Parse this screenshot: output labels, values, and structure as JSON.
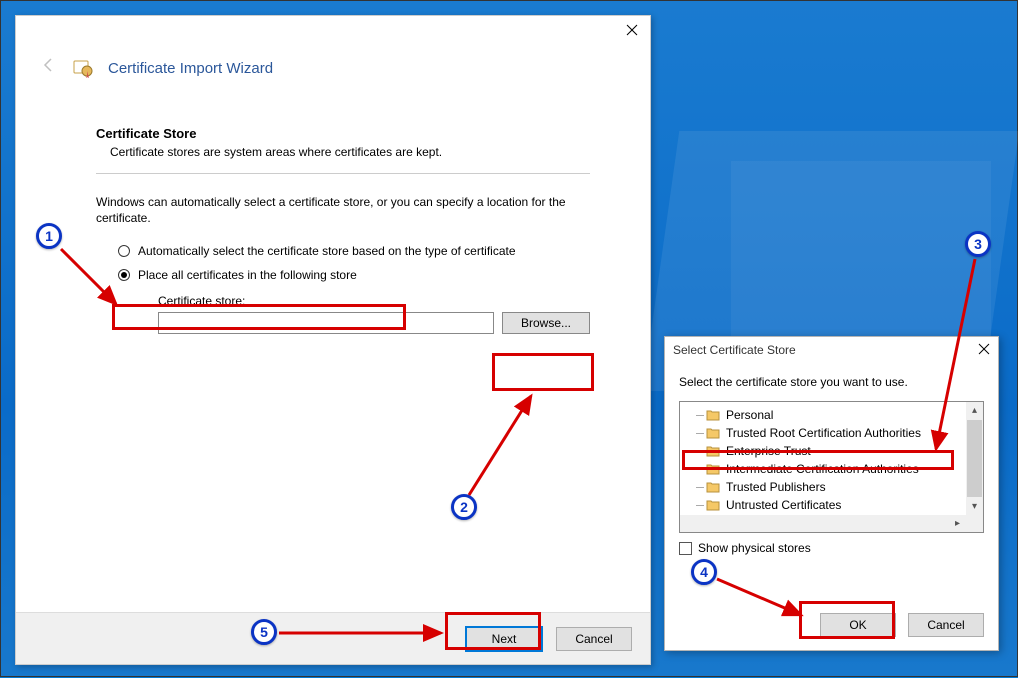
{
  "wizard": {
    "title": "Certificate Import Wizard",
    "section_title": "Certificate Store",
    "section_desc": "Certificate stores are system areas where certificates are kept.",
    "instruction": "Windows can automatically select a certificate store, or you can specify a location for the certificate.",
    "radio_auto": "Automatically select the certificate store based on the type of certificate",
    "radio_place": "Place all certificates in the following store",
    "store_label": "Certificate store:",
    "store_value": "",
    "browse": "Browse...",
    "next": "Next",
    "cancel": "Cancel"
  },
  "sel": {
    "title": "Select Certificate Store",
    "instruction": "Select the certificate store you want to use.",
    "items": {
      "0": "Personal",
      "1": "Trusted Root Certification Authorities",
      "2": "Enterprise Trust",
      "3": "Intermediate Certification Authorities",
      "4": "Trusted Publishers",
      "5": "Untrusted Certificates"
    },
    "show_physical": "Show physical stores",
    "ok": "OK",
    "cancel": "Cancel"
  },
  "badges": {
    "1": "1",
    "2": "2",
    "3": "3",
    "4": "4",
    "5": "5"
  }
}
